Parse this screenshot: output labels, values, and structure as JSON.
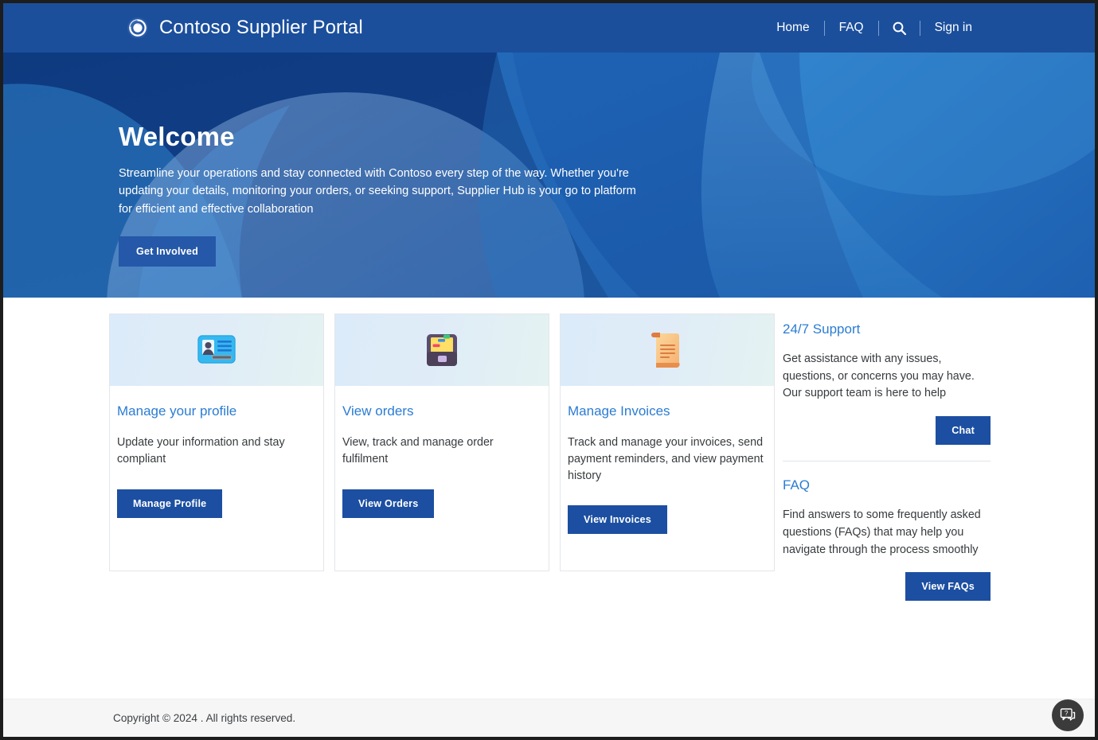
{
  "header": {
    "logo_icon": "contoso-swirl-logo",
    "title": "Contoso Supplier Portal",
    "nav": {
      "home": "Home",
      "faq": "FAQ",
      "search_icon": "search-icon",
      "sign_in": "Sign in"
    }
  },
  "hero": {
    "title": "Welcome",
    "subtitle": "Streamline your operations and stay connected with Contoso every step of the way. Whether you're updating your details, monitoring your orders, or seeking support, Supplier Hub is your go to platform for efficient and effective collaboration",
    "cta": "Get Involved"
  },
  "cards": [
    {
      "icon": "id-card-icon",
      "title": "Manage your profile",
      "text": "Update your information and stay compliant",
      "button": "Manage Profile"
    },
    {
      "icon": "card-file-box-icon",
      "title": "View orders",
      "text": "View, track and manage order fulfilment",
      "button": "View Orders"
    },
    {
      "icon": "scroll-document-icon",
      "title": "Manage Invoices",
      "text": "Track and manage your invoices, send payment reminders, and view payment history",
      "button": "View Invoices"
    }
  ],
  "side": [
    {
      "title": "24/7 Support",
      "text": "Get assistance with any issues, questions, or concerns you may have. Our support team is here to help",
      "button": "Chat"
    },
    {
      "title": "FAQ",
      "text": "Find answers to some frequently asked questions (FAQs) that may help you navigate through the process smoothly",
      "button": "View FAQs"
    }
  ],
  "footer": {
    "copyright": "Copyright © 2024 . All rights reserved."
  },
  "chat_widget": {
    "icon": "chat-help-bubble-icon"
  },
  "colors": {
    "header_blue": "#1b4f9c",
    "hero_navy": "#103b82",
    "button_blue": "#1c4fa1",
    "link_blue": "#2b7cd3",
    "card_media_blue": "#dcebf9",
    "footer_grey": "#f6f6f6"
  }
}
